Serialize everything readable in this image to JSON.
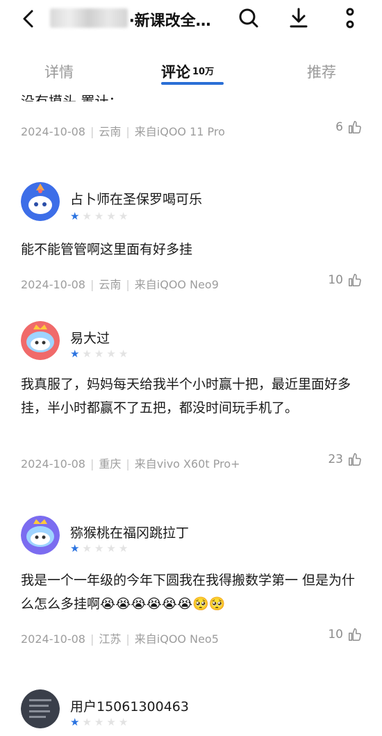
{
  "header": {
    "title": "‧新课改全…",
    "back_icon": "back-arrow-icon",
    "search_icon": "search-icon",
    "download_icon": "download-icon",
    "more_icon": "more-vertical-icon"
  },
  "tabs": [
    {
      "label": "详情"
    },
    {
      "label": "评论",
      "badge": "10万"
    },
    {
      "label": "推荐"
    }
  ],
  "top_partial": {
    "text": "没有摸头 置计；",
    "date": "2024-10-08",
    "region": "云南",
    "device": "来自iQOO 11 Pro",
    "likes": "6"
  },
  "reviews": [
    {
      "user": "占卜师在圣保罗喝可乐",
      "stars": 1,
      "text": "能不能管管啊这里面有好多挂",
      "date": "2024-10-08",
      "region": "云南",
      "device": "来自iQOO Neo9",
      "likes": "10"
    },
    {
      "user": "易大过",
      "stars": 1,
      "text": "我真服了，妈妈每天给我半个小时赢十把，最近里面好多挂，半小时都赢不了五把，都没时间玩手机了。",
      "date": "2024-10-08",
      "region": "重庆",
      "device": "来自vivo X60t Pro+",
      "likes": "23"
    },
    {
      "user": "猕猴桃在福冈跳拉丁",
      "stars": 1,
      "text": "我是一个一年级的今年下圆我在我得搬数学第一 但是为什么怎么多挂啊😭😭😭😭😭😭🥺🥺",
      "date": "2024-10-08",
      "region": "江苏",
      "device": "来自iQOO Neo5",
      "likes": "10"
    },
    {
      "user": "用户15061300463",
      "stars": 1
    }
  ],
  "colors": {
    "accent": "#2a6fd6",
    "star": "#2b73e0",
    "meta": "#9d9d9d"
  }
}
